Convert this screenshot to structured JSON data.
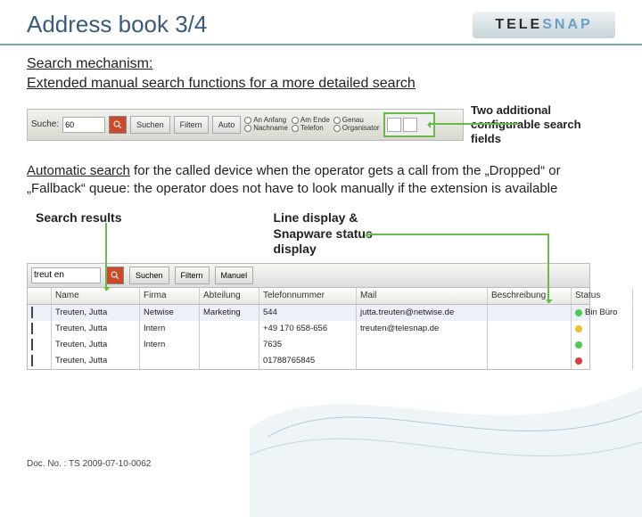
{
  "header": {
    "title": "Address book 3/4",
    "logo_tele": "TELE",
    "logo_snap": "SNAP"
  },
  "sub1_l1": "Search mechanism:",
  "sub1_l2": "Extended manual search functions for a more detailed search",
  "tb1": {
    "suche_label": "Suche:",
    "input_value": "60",
    "btn_suchen": "Suchen",
    "btn_privat": "Filtern",
    "btn_auto": "Auto",
    "r1a": "An Anfang",
    "r1b": "Am Ende",
    "r1c": "Genau",
    "r2a": "Nachname",
    "r2b": "Telefon",
    "r2c": "Organisator"
  },
  "callout1": "Two additional configurable search fields",
  "para_html": {
    "p1a": "Automatic search",
    "p1b": " for the called device when the operator gets a call from the „Dropped“ or „Fallback“ queue: the operator does not have to look manually if the extension is available"
  },
  "label_search_results": "Search results",
  "label_line_display": "Line display & Snapware status display",
  "tb2": {
    "input_value": "treut en",
    "btn_suchen": "Suchen",
    "btn_privat": "Filtern",
    "btn_manual": "Manuel"
  },
  "cols": {
    "name": "Name",
    "firma": "Firma",
    "abt": "Abteilung",
    "num": "Telefonnummer",
    "mail": "Mail",
    "besch": "Beschreibung",
    "status": "Status"
  },
  "rows": [
    {
      "name": "Treuten, Jutta",
      "firma": "Netwise",
      "abt": "Marketing",
      "num": "544",
      "mail": "jutta.treuten@netwise.de",
      "besch": "",
      "status": "Bin Büro",
      "dot": "g"
    },
    {
      "name": "Treuten, Jutta",
      "firma": "Intern",
      "abt": "",
      "num": "+49 170 658-656",
      "mail": "treuten@telesnap.de",
      "besch": "",
      "status": "",
      "dot": "y"
    },
    {
      "name": "Treuten, Jutta",
      "firma": "Intern",
      "abt": "",
      "num": "7635",
      "mail": "",
      "besch": "",
      "status": "",
      "dot": "g"
    },
    {
      "name": "Treuten, Jutta",
      "firma": "",
      "abt": "",
      "num": "01788765845",
      "mail": "",
      "besch": "",
      "status": "",
      "dot": "r"
    }
  ],
  "docno": "Doc. No. : TS 2009-07-10-0062"
}
